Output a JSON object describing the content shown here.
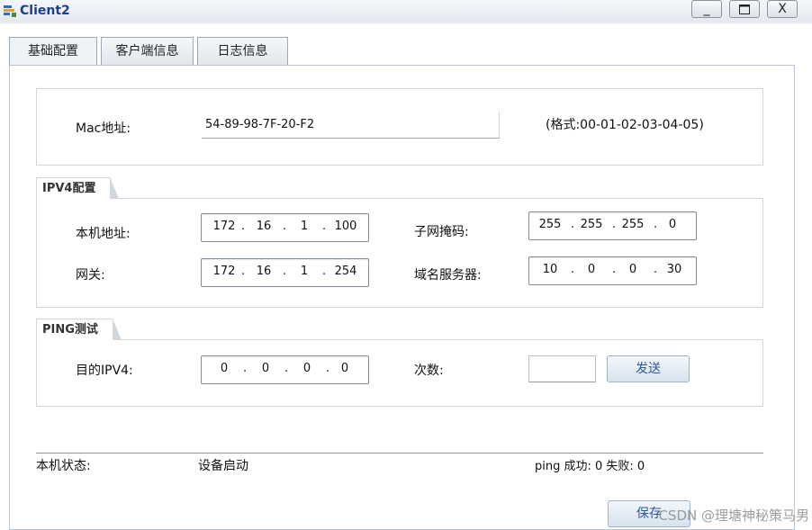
{
  "window": {
    "title": "Client2",
    "minimize_glyph": "_",
    "maximize_glyph": "□",
    "close_glyph": "X"
  },
  "tabs": [
    {
      "label": "基础配置",
      "active": true
    },
    {
      "label": "客户端信息",
      "active": false
    },
    {
      "label": "日志信息",
      "active": false
    }
  ],
  "mac": {
    "label": "Mac地址:",
    "value": "54-89-98-7F-20-F2",
    "hint": "(格式:00-01-02-03-04-05)"
  },
  "ipv4": {
    "legend": "IPV4配置",
    "local_label": "本机地址:",
    "local": [
      "172",
      "16",
      "1",
      "100"
    ],
    "mask_label": "子网掩码:",
    "mask": [
      "255",
      "255",
      "255",
      "0"
    ],
    "gateway_label": "网关:",
    "gateway": [
      "172",
      "16",
      "1",
      "254"
    ],
    "dns_label": "域名服务器:",
    "dns": [
      "10",
      "0",
      "0",
      "30"
    ]
  },
  "ping": {
    "legend": "PING测试",
    "target_label": "目的IPV4:",
    "target": [
      "0",
      "0",
      "0",
      "0"
    ],
    "count_label": "次数:",
    "count_value": "",
    "send_label": "发送"
  },
  "status": {
    "label": "本机状态:",
    "value": "设备启动",
    "ping_result": "ping 成功: 0 失败: 0"
  },
  "save_label": "保存",
  "watermark": "CSDN @理塘神秘策马男",
  "colors": {
    "title_text": "#1b3f8b",
    "button_text": "#2a56a5"
  }
}
